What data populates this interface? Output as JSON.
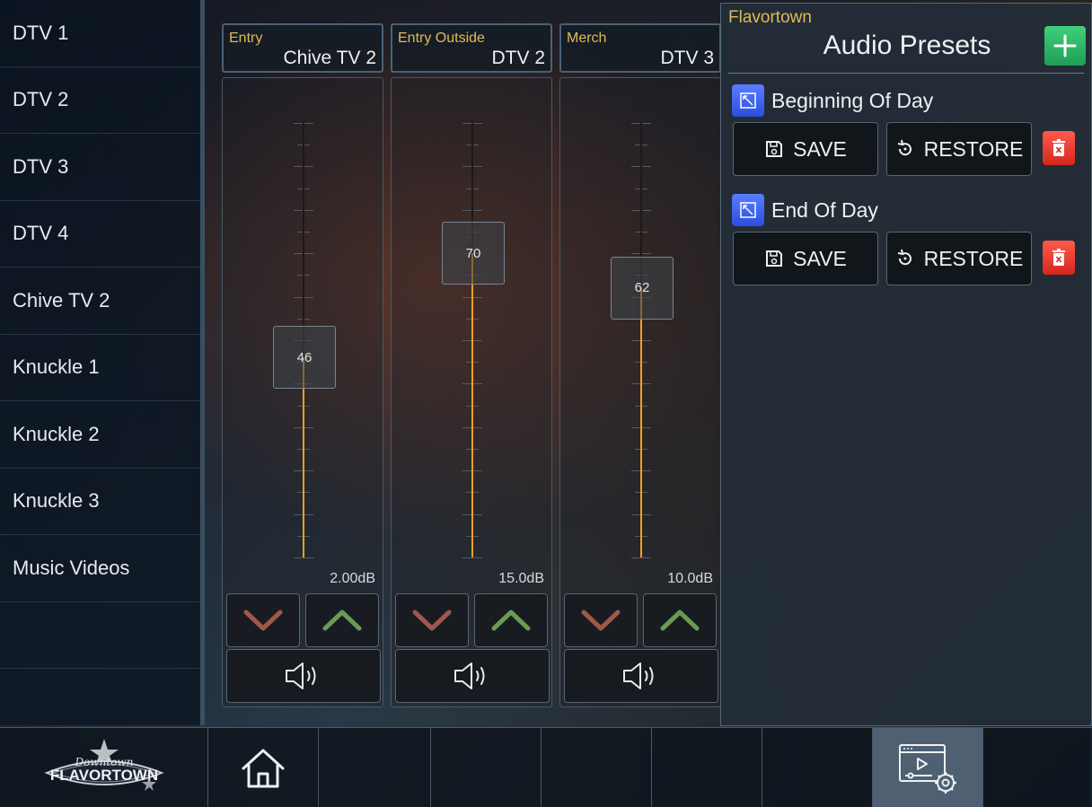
{
  "sidebar": {
    "items": [
      {
        "label": "DTV 1"
      },
      {
        "label": "DTV 2"
      },
      {
        "label": "DTV 3"
      },
      {
        "label": "DTV 4"
      },
      {
        "label": "Chive TV 2"
      },
      {
        "label": "Knuckle 1"
      },
      {
        "label": "Knuckle 2"
      },
      {
        "label": "Knuckle 3"
      },
      {
        "label": "Music Videos"
      }
    ]
  },
  "channels": [
    {
      "group": "Entry",
      "source": "Chive TV 2",
      "level": 46,
      "db": "2.00dB"
    },
    {
      "group": "Entry Outside",
      "source": "DTV 2",
      "level": 70,
      "db": "15.0dB"
    },
    {
      "group": "Merch",
      "source": "DTV 3",
      "level": 62,
      "db": "10.0dB"
    }
  ],
  "colors": {
    "accent": "#f0a020",
    "group_label": "#e1b957",
    "add": "#2db866",
    "delete": "#e0342a",
    "edit": "#3a5ff0"
  },
  "presets": {
    "room": "Flavortown",
    "title": "Audio Presets",
    "items": [
      {
        "name": "Beginning Of Day",
        "save_label": "SAVE",
        "restore_label": "RESTORE"
      },
      {
        "name": "End Of Day",
        "save_label": "SAVE",
        "restore_label": "RESTORE"
      }
    ]
  },
  "bottom_bar": {
    "logo_top": "Downtown",
    "logo_main": "FLAVORTOWN",
    "icons": [
      "home-icon",
      "media-settings-icon"
    ]
  }
}
